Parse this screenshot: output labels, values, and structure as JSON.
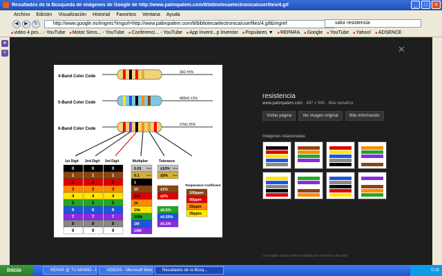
{
  "window": {
    "title": "Resultados de la Búsqueda de imágenes de Google de http://www.palimpalem.com/8/bibliotecaelectronica/userfiles/4.gif"
  },
  "menu": [
    "Archivo",
    "Edición",
    "Visualización",
    "Historial",
    "Favoritos",
    "Ventana",
    "Ayuda"
  ],
  "nav": {
    "url": "http://www.google.es/imgres?imgurl=http://www.palimpalem.com/8/bibliotecaelectronica/userfiles/4.gif&imgref",
    "search": "valor resistencia"
  },
  "bookmarks": [
    "video 4 pro... - YouTube",
    "Motor Sens... - YouTube",
    "Conferenci... - YouTube",
    "App Invent...p Inventor",
    "Populares ▼",
    "REPARA",
    "Google",
    "YouTube",
    "Yahoo!",
    "ADSENCE"
  ],
  "figure": {
    "bands": [
      "4-Band Color Code",
      "5-Band Color Code",
      "6-Band Color Code"
    ],
    "values": [
      "2kΩ ±5%",
      "460kΩ ±1%",
      "27kΩ ±5%"
    ],
    "columns": [
      "1st Digit",
      "2nd Digit",
      "3rd Digit",
      "Multiplier",
      "Tolerance",
      "Temperature Coefficient"
    ],
    "digits": [
      "0",
      "1",
      "2",
      "3",
      "4",
      "5",
      "6",
      "7",
      "8",
      "9"
    ],
    "multipliers": [
      "0.01",
      "0.1",
      "1",
      "10",
      "100",
      "1k",
      "10k",
      "100k",
      "1M",
      "10M"
    ],
    "tolerances": [
      "±10%",
      "±5%",
      "±1%",
      "±2%",
      "±0.5%",
      "±0.25%",
      "±0.1%"
    ],
    "silver": "Silver",
    "gold": "Gold",
    "temp": [
      "100ppm",
      "50ppm",
      "15ppm",
      "25ppm"
    ]
  },
  "info": {
    "query": "resistencia",
    "site": "www.palimpalem.com",
    "size": " · 487 × 500 · Más tamaños",
    "buttons": [
      "Visitar página",
      "Ver imagen original",
      "Más información"
    ],
    "related": "Imágenes relacionadas",
    "footnote": "La imagen puede estar protegida por derechos de autor."
  },
  "taskbar": {
    "start": "Inicio",
    "tasks": [
      "REPAR @ TU MISMO - FO...",
      "VIDEOS - Microsoft Word",
      "Resultados de la Búsq..."
    ],
    "clock": "0:15"
  },
  "colors": {
    "digit_colors": [
      "#000000",
      "#8b4513",
      "#e00000",
      "#ff8c00",
      "#ffe600",
      "#22a822",
      "#1e55e0",
      "#8a2be2",
      "#888888",
      "#ffffff"
    ]
  }
}
